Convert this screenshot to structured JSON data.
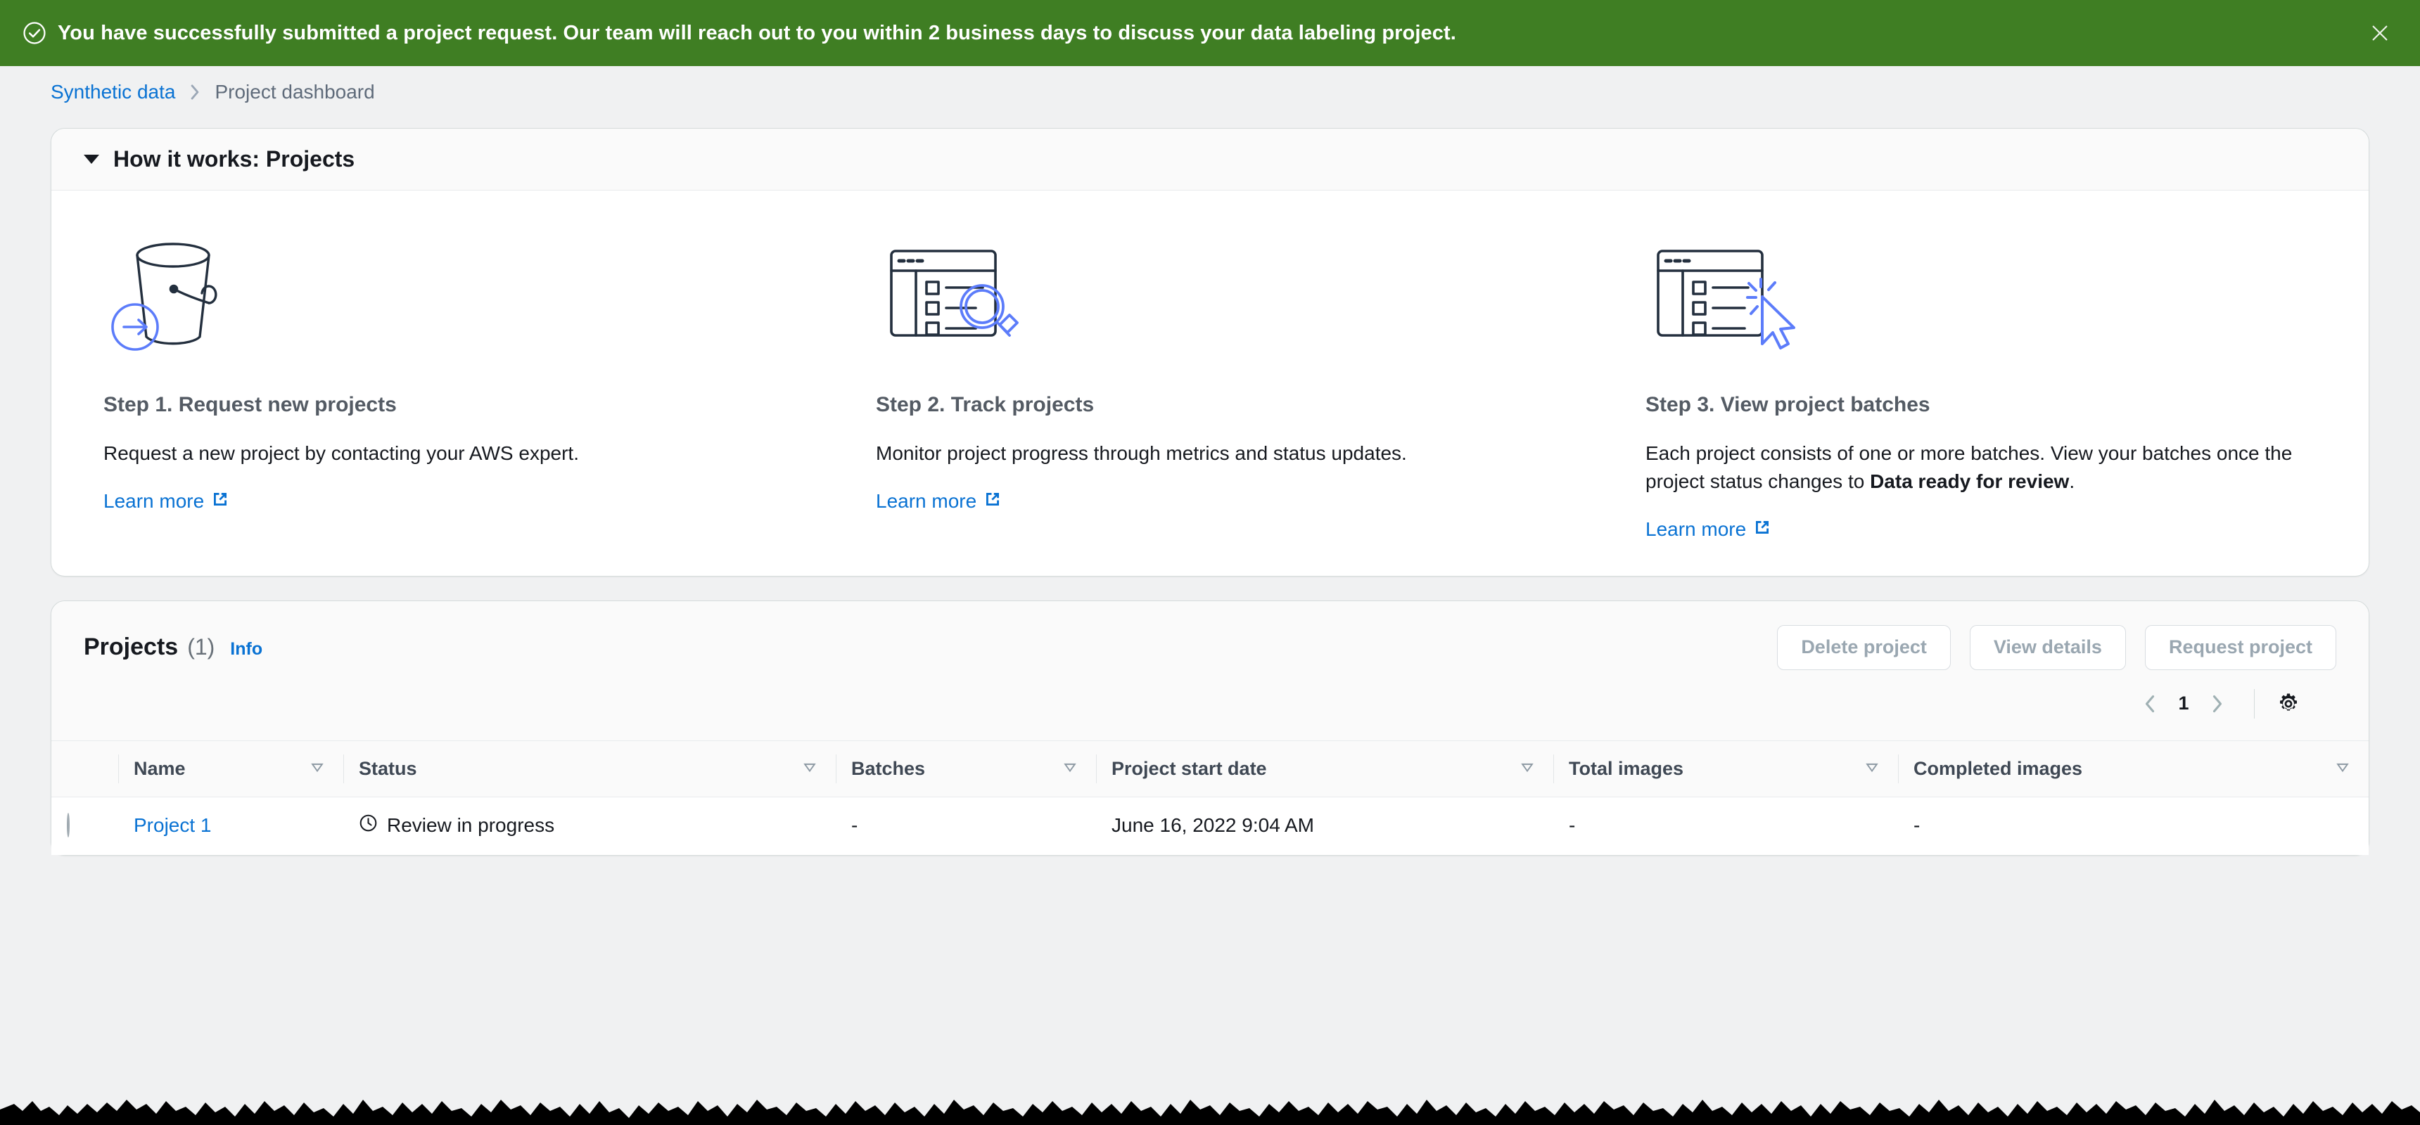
{
  "flash": {
    "message": "You have successfully submitted a project request. Our team will reach out to you within 2 business days to discuss your data labeling project.",
    "success_color": "#3f7e23",
    "icon": "status-positive-icon",
    "close_icon": "close-icon"
  },
  "breadcrumb": {
    "root": "Synthetic data",
    "separator": "›",
    "current": "Project dashboard"
  },
  "how_it_works": {
    "title": "How it works: Projects",
    "expanded": true,
    "steps": [
      {
        "illustration": "s3-bucket-arrow-icon",
        "title": "Step 1. Request new projects",
        "description": "Request a new project by contacting your AWS expert.",
        "link_label": "Learn more"
      },
      {
        "illustration": "browser-checklist-magnifier-icon",
        "title": "Step 2. Track projects",
        "description": "Monitor project progress through metrics and status updates.",
        "link_label": "Learn more"
      },
      {
        "illustration": "browser-checklist-cursor-icon",
        "title": "Step 3. View project batches",
        "description_before": "Each project consists of one or more batches. View your batches once the project status changes to ",
        "description_bold": "Data ready for review",
        "description_after": ".",
        "link_label": "Learn more"
      }
    ]
  },
  "projects": {
    "title": "Projects",
    "count": "(1)",
    "info_label": "Info",
    "buttons": [
      {
        "label": "Delete project",
        "disabled": true
      },
      {
        "label": "View details",
        "disabled": true
      },
      {
        "label": "Request project",
        "disabled": true
      }
    ],
    "pagination": {
      "prev_icon": "chevron-left-icon",
      "page": "1",
      "next_icon": "chevron-right-icon",
      "settings_icon": "gear-icon"
    },
    "columns": [
      {
        "label": "Name",
        "sortable": true
      },
      {
        "label": "Status",
        "sortable": true
      },
      {
        "label": "Batches",
        "sortable": true
      },
      {
        "label": "Project start date",
        "sortable": true
      },
      {
        "label": "Total images",
        "sortable": true
      },
      {
        "label": "Completed images",
        "sortable": true
      }
    ],
    "rows": [
      {
        "selected": false,
        "name": "Project 1",
        "status": "Review in progress",
        "status_icon": "pending-clock-icon",
        "batches": "-",
        "start_date": "June 16, 2022 9:04 AM",
        "total_images": "-",
        "completed_images": "-"
      }
    ]
  },
  "colors": {
    "link": "#0972d3",
    "success_banner": "#3f7e23",
    "page_background": "#f0f1f2",
    "illustration_accent": "#5c7cfa",
    "illustration_dark": "#232f3e"
  }
}
